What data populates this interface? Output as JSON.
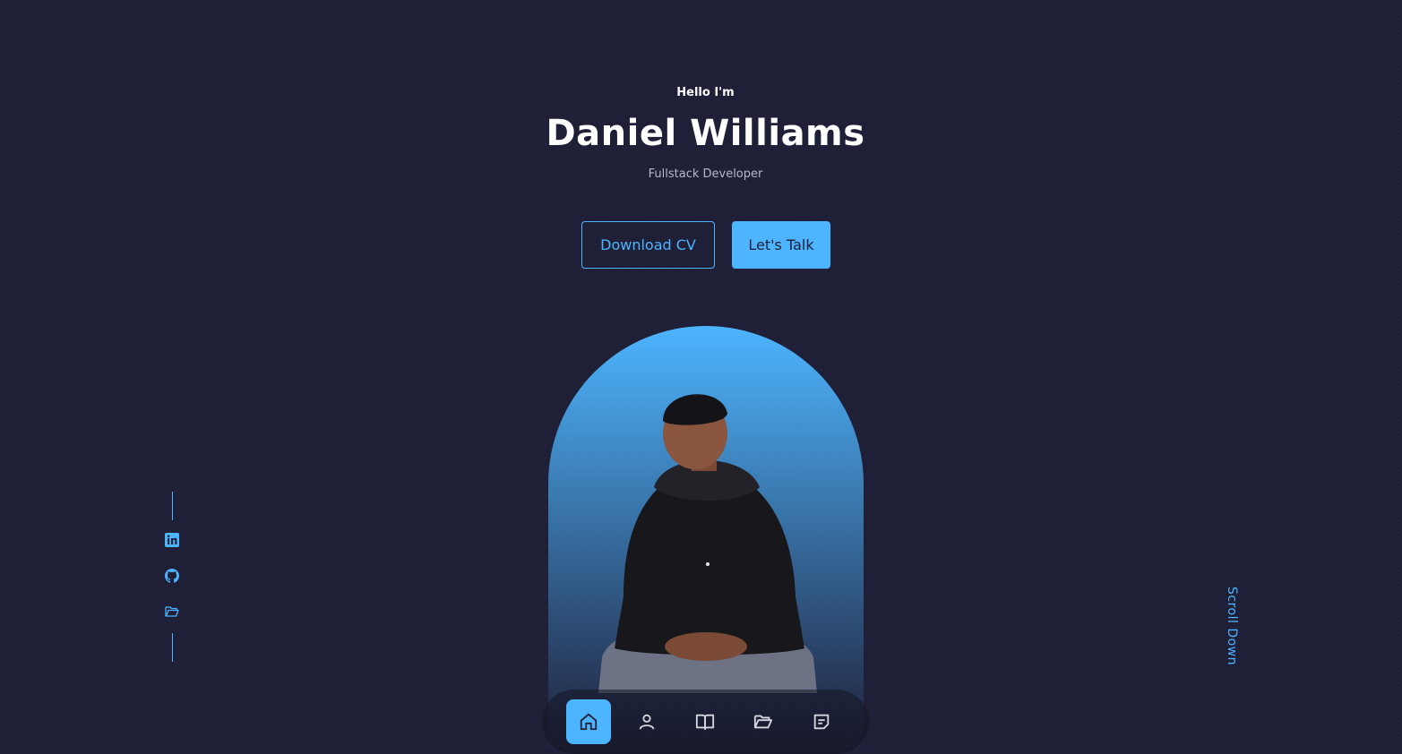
{
  "colors": {
    "background": "#1f1f38",
    "primary": "#4db5ff",
    "text": "#ffffff",
    "muted": "#b7b7c6"
  },
  "hero": {
    "greeting": "Hello I'm",
    "name": "Daniel Williams",
    "role": "Fullstack Developer"
  },
  "buttons": {
    "download_cv": "Download CV",
    "lets_talk": "Let's Talk"
  },
  "socials": [
    {
      "icon": "linkedin-icon"
    },
    {
      "icon": "github-icon"
    },
    {
      "icon": "folder-icon"
    }
  ],
  "scroll_down": "Scroll Down",
  "nav": [
    {
      "icon": "home-icon",
      "active": true
    },
    {
      "icon": "user-icon",
      "active": false
    },
    {
      "icon": "book-icon",
      "active": false
    },
    {
      "icon": "folder-icon",
      "active": false
    },
    {
      "icon": "message-icon",
      "active": false
    }
  ]
}
